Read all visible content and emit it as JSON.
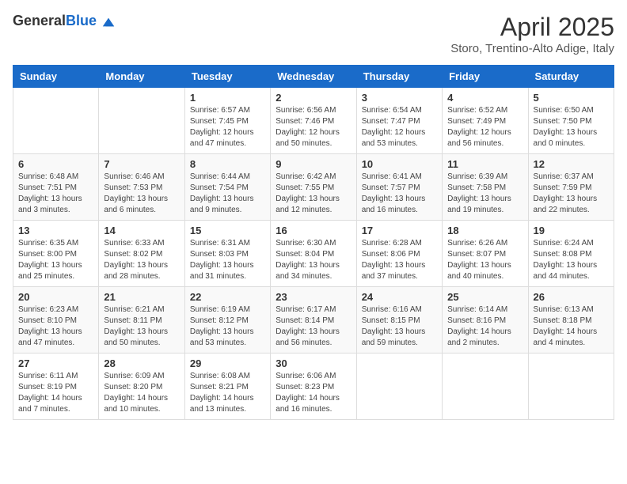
{
  "header": {
    "logo_general": "General",
    "logo_blue": "Blue",
    "title": "April 2025",
    "subtitle": "Storo, Trentino-Alto Adige, Italy"
  },
  "weekdays": [
    "Sunday",
    "Monday",
    "Tuesday",
    "Wednesday",
    "Thursday",
    "Friday",
    "Saturday"
  ],
  "weeks": [
    [
      {
        "day": "",
        "info": ""
      },
      {
        "day": "",
        "info": ""
      },
      {
        "day": "1",
        "info": "Sunrise: 6:57 AM\nSunset: 7:45 PM\nDaylight: 12 hours and 47 minutes."
      },
      {
        "day": "2",
        "info": "Sunrise: 6:56 AM\nSunset: 7:46 PM\nDaylight: 12 hours and 50 minutes."
      },
      {
        "day": "3",
        "info": "Sunrise: 6:54 AM\nSunset: 7:47 PM\nDaylight: 12 hours and 53 minutes."
      },
      {
        "day": "4",
        "info": "Sunrise: 6:52 AM\nSunset: 7:49 PM\nDaylight: 12 hours and 56 minutes."
      },
      {
        "day": "5",
        "info": "Sunrise: 6:50 AM\nSunset: 7:50 PM\nDaylight: 13 hours and 0 minutes."
      }
    ],
    [
      {
        "day": "6",
        "info": "Sunrise: 6:48 AM\nSunset: 7:51 PM\nDaylight: 13 hours and 3 minutes."
      },
      {
        "day": "7",
        "info": "Sunrise: 6:46 AM\nSunset: 7:53 PM\nDaylight: 13 hours and 6 minutes."
      },
      {
        "day": "8",
        "info": "Sunrise: 6:44 AM\nSunset: 7:54 PM\nDaylight: 13 hours and 9 minutes."
      },
      {
        "day": "9",
        "info": "Sunrise: 6:42 AM\nSunset: 7:55 PM\nDaylight: 13 hours and 12 minutes."
      },
      {
        "day": "10",
        "info": "Sunrise: 6:41 AM\nSunset: 7:57 PM\nDaylight: 13 hours and 16 minutes."
      },
      {
        "day": "11",
        "info": "Sunrise: 6:39 AM\nSunset: 7:58 PM\nDaylight: 13 hours and 19 minutes."
      },
      {
        "day": "12",
        "info": "Sunrise: 6:37 AM\nSunset: 7:59 PM\nDaylight: 13 hours and 22 minutes."
      }
    ],
    [
      {
        "day": "13",
        "info": "Sunrise: 6:35 AM\nSunset: 8:00 PM\nDaylight: 13 hours and 25 minutes."
      },
      {
        "day": "14",
        "info": "Sunrise: 6:33 AM\nSunset: 8:02 PM\nDaylight: 13 hours and 28 minutes."
      },
      {
        "day": "15",
        "info": "Sunrise: 6:31 AM\nSunset: 8:03 PM\nDaylight: 13 hours and 31 minutes."
      },
      {
        "day": "16",
        "info": "Sunrise: 6:30 AM\nSunset: 8:04 PM\nDaylight: 13 hours and 34 minutes."
      },
      {
        "day": "17",
        "info": "Sunrise: 6:28 AM\nSunset: 8:06 PM\nDaylight: 13 hours and 37 minutes."
      },
      {
        "day": "18",
        "info": "Sunrise: 6:26 AM\nSunset: 8:07 PM\nDaylight: 13 hours and 40 minutes."
      },
      {
        "day": "19",
        "info": "Sunrise: 6:24 AM\nSunset: 8:08 PM\nDaylight: 13 hours and 44 minutes."
      }
    ],
    [
      {
        "day": "20",
        "info": "Sunrise: 6:23 AM\nSunset: 8:10 PM\nDaylight: 13 hours and 47 minutes."
      },
      {
        "day": "21",
        "info": "Sunrise: 6:21 AM\nSunset: 8:11 PM\nDaylight: 13 hours and 50 minutes."
      },
      {
        "day": "22",
        "info": "Sunrise: 6:19 AM\nSunset: 8:12 PM\nDaylight: 13 hours and 53 minutes."
      },
      {
        "day": "23",
        "info": "Sunrise: 6:17 AM\nSunset: 8:14 PM\nDaylight: 13 hours and 56 minutes."
      },
      {
        "day": "24",
        "info": "Sunrise: 6:16 AM\nSunset: 8:15 PM\nDaylight: 13 hours and 59 minutes."
      },
      {
        "day": "25",
        "info": "Sunrise: 6:14 AM\nSunset: 8:16 PM\nDaylight: 14 hours and 2 minutes."
      },
      {
        "day": "26",
        "info": "Sunrise: 6:13 AM\nSunset: 8:18 PM\nDaylight: 14 hours and 4 minutes."
      }
    ],
    [
      {
        "day": "27",
        "info": "Sunrise: 6:11 AM\nSunset: 8:19 PM\nDaylight: 14 hours and 7 minutes."
      },
      {
        "day": "28",
        "info": "Sunrise: 6:09 AM\nSunset: 8:20 PM\nDaylight: 14 hours and 10 minutes."
      },
      {
        "day": "29",
        "info": "Sunrise: 6:08 AM\nSunset: 8:21 PM\nDaylight: 14 hours and 13 minutes."
      },
      {
        "day": "30",
        "info": "Sunrise: 6:06 AM\nSunset: 8:23 PM\nDaylight: 14 hours and 16 minutes."
      },
      {
        "day": "",
        "info": ""
      },
      {
        "day": "",
        "info": ""
      },
      {
        "day": "",
        "info": ""
      }
    ]
  ]
}
